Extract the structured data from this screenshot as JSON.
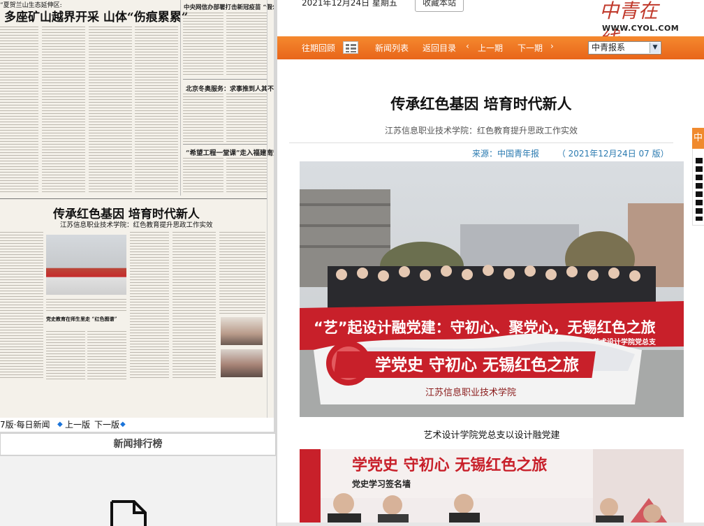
{
  "newspaper": {
    "tagline": "“夏贺兰山生态延伸区:",
    "top_headline": "多座矿山越界开采 山体“伤痕累累”",
    "side_headline_1": "中央网信办部署打击新冠疫苗 “假公关”网络水军",
    "side_headline_2": "北京冬奥服务：求事推到人其不可踏出闭环",
    "side_headline_3": "“希望工程一堂课”走入福建南安",
    "featured_headline": "传承红色基因 培育时代新人",
    "featured_subhead": "江苏信息职业技术学院：红色教育提升思政工作实效",
    "inline_head_1": "党史教育在师生里走 “红色图谱”",
    "footer": {
      "page_label": "7版·每日新闻",
      "prev": "上一版",
      "next": "下一版"
    }
  },
  "ranking": {
    "title": "新闻排行榜"
  },
  "topbar": {
    "date": "2021年12月24日 星期五",
    "favorite_button": "收藏本站",
    "logo_text": "中青在线",
    "url": "WWW.CYOL.COM"
  },
  "nav": {
    "items": [
      "往期回顾",
      "新闻列表",
      "返回目录",
      "上一期",
      "下一期"
    ],
    "select_value": "中青报系"
  },
  "article": {
    "title": "传承红色基因 培育时代新人",
    "subtitle": "江苏信息职业技术学院：红色教育提升思政工作实效",
    "source_label": "来源：中国青年报",
    "date_edition": "（ 2021年12月24日 07 版）",
    "photo1_banner_main": "“艺”起设计融党建：守初心、聚党心，无锡红色之旅",
    "photo1_banner_sub": "——艺术设计学院党总支",
    "photo1_board": "学党史 守初心 无锡红色之旅",
    "photo1_board_logo": "江苏信息职业技术学院",
    "caption1": "艺术设计学院党总支以设计融党建",
    "photo2_banner": "学党史 守初心 无锡红色之旅",
    "photo2_wall": "党史学习签名墙"
  },
  "share": {
    "label": "中"
  },
  "colors": {
    "nav_orange": "#ee7420",
    "link_blue": "#2a7ab0",
    "banner_red": "#c8202a"
  }
}
